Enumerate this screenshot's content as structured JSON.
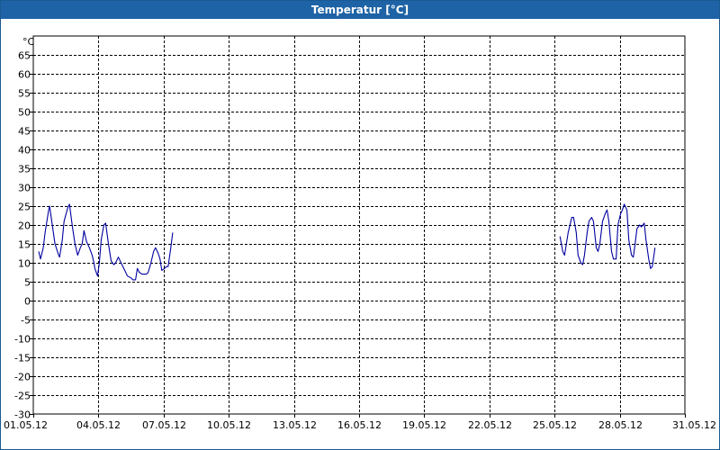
{
  "window": {
    "title": "Temperatur [°C]"
  },
  "chart_data": {
    "type": "line",
    "title": "Temperatur [°C]",
    "ylabel": "°C",
    "ylim": [
      -30,
      70
    ],
    "yticks": [
      -30,
      -25,
      -20,
      -15,
      -10,
      -5,
      0,
      5,
      10,
      15,
      20,
      25,
      30,
      35,
      40,
      45,
      50,
      55,
      60,
      65
    ],
    "xlim": [
      "01.05.12",
      "31.05.12"
    ],
    "xticks": [
      "01.05.12",
      "04.05.12",
      "07.05.12",
      "10.05.12",
      "13.05.12",
      "16.05.12",
      "19.05.12",
      "22.05.12",
      "25.05.12",
      "28.05.12",
      "31.05.12"
    ],
    "grid": true,
    "line_color": "#0000a0",
    "series": [
      {
        "segments": [
          [
            [
              "01.05.12 06:00",
              13
            ],
            [
              "01.05.12 08:00",
              11
            ],
            [
              "01.05.12 11:00",
              14
            ],
            [
              "01.05.12 13:00",
              18
            ],
            [
              "01.05.12 17:00",
              24
            ],
            [
              "01.05.12 18:00",
              25
            ],
            [
              "01.05.12 21:00",
              20
            ],
            [
              "02.05.12 00:00",
              15
            ],
            [
              "02.05.12 04:00",
              12
            ],
            [
              "02.05.12 05:00",
              11.5
            ],
            [
              "02.05.12 08:00",
              16
            ],
            [
              "02.05.12 10:00",
              21
            ],
            [
              "02.05.12 14:00",
              24.5
            ],
            [
              "02.05.12 16:00",
              25.5
            ],
            [
              "02.05.12 19:00",
              20
            ],
            [
              "02.05.12 22:00",
              15
            ],
            [
              "03.05.12 01:00",
              12
            ],
            [
              "03.05.12 04:00",
              14
            ],
            [
              "03.05.12 06:00",
              15
            ],
            [
              "03.05.12 08:00",
              18.5
            ],
            [
              "03.05.12 11:00",
              15.5
            ],
            [
              "03.05.12 14:00",
              14
            ],
            [
              "03.05.12 17:00",
              12
            ],
            [
              "03.05.12 19:00",
              10
            ],
            [
              "03.05.12 20:00",
              8.5
            ],
            [
              "03.05.12 23:00",
              6.5
            ],
            [
              "04.05.12 01:00",
              10
            ],
            [
              "04.05.12 03:00",
              16
            ],
            [
              "04.05.12 06:00",
              20
            ],
            [
              "04.05.12 08:00",
              20.5
            ],
            [
              "04.05.12 11:00",
              15
            ],
            [
              "04.05.12 14:00",
              10.5
            ],
            [
              "04.05.12 17:00",
              9.5
            ],
            [
              "04.05.12 19:00",
              10
            ],
            [
              "04.05.12 22:00",
              11.5
            ],
            [
              "05.05.12 01:00",
              10
            ],
            [
              "05.05.12 05:00",
              8
            ],
            [
              "05.05.12 08:00",
              6.5
            ],
            [
              "05.05.12 12:00",
              6
            ],
            [
              "05.05.12 14:00",
              5.5
            ],
            [
              "05.05.12 17:00",
              5.5
            ],
            [
              "05.05.12 19:00",
              8.5
            ],
            [
              "05.05.12 21:00",
              7.5
            ],
            [
              "06.05.12 00:00",
              7
            ],
            [
              "06.05.12 05:00",
              7
            ],
            [
              "06.05.12 07:00",
              7.5
            ],
            [
              "06.05.12 10:00",
              10
            ],
            [
              "06.05.12 13:00",
              13
            ],
            [
              "06.05.12 15:00",
              14
            ],
            [
              "06.05.12 18:00",
              12.5
            ],
            [
              "06.05.12 20:00",
              11
            ],
            [
              "06.05.12 22:00",
              8
            ],
            [
              "07.05.12 01:00",
              8.5
            ],
            [
              "07.05.12 03:00",
              9
            ],
            [
              "07.05.12 05:00",
              9
            ],
            [
              "07.05.12 08:00",
              14
            ],
            [
              "07.05.12 10:00",
              18
            ]
          ],
          [
            [
              "25.05.12 06:00",
              17
            ],
            [
              "25.05.12 09:00",
              13
            ],
            [
              "25.05.12 11:00",
              12
            ],
            [
              "25.05.12 13:00",
              15
            ],
            [
              "25.05.12 15:00",
              18
            ],
            [
              "25.05.12 19:00",
              22
            ],
            [
              "25.05.12 21:00",
              22
            ],
            [
              "26.05.12 00:00",
              18
            ],
            [
              "26.05.12 02:00",
              12
            ],
            [
              "26.05.12 05:00",
              10
            ],
            [
              "26.05.12 07:00",
              9.5
            ],
            [
              "26.05.12 09:00",
              12
            ],
            [
              "26.05.12 12:00",
              18
            ],
            [
              "26.05.12 14:00",
              21
            ],
            [
              "26.05.12 17:00",
              22
            ],
            [
              "26.05.12 19:00",
              21
            ],
            [
              "26.05.12 22:00",
              14
            ],
            [
              "27.05.12 00:00",
              13
            ],
            [
              "27.05.12 02:00",
              15
            ],
            [
              "27.05.12 05:00",
              21
            ],
            [
              "27.05.12 08:00",
              23
            ],
            [
              "27.05.12 10:00",
              24
            ],
            [
              "27.05.12 12:00",
              21
            ],
            [
              "27.05.12 15:00",
              13
            ],
            [
              "27.05.12 17:00",
              11
            ],
            [
              "27.05.12 20:00",
              11
            ],
            [
              "27.05.12 22:00",
              20
            ],
            [
              "28.05.12 01:00",
              23
            ],
            [
              "28.05.12 03:00",
              24
            ],
            [
              "28.05.12 05:00",
              25.5
            ],
            [
              "28.05.12 08:00",
              24
            ],
            [
              "28.05.12 10:00",
              16
            ],
            [
              "28.05.12 13:00",
              12
            ],
            [
              "28.05.12 15:00",
              11.5
            ],
            [
              "28.05.12 17:00",
              15
            ],
            [
              "28.05.12 19:00",
              19
            ],
            [
              "28.05.12 22:00",
              20
            ],
            [
              "29.05.12 00:00",
              19.5
            ],
            [
              "29.05.12 03:00",
              20.5
            ],
            [
              "29.05.12 05:00",
              16
            ],
            [
              "29.05.12 08:00",
              11
            ],
            [
              "29.05.12 10:00",
              8.5
            ],
            [
              "29.05.12 12:00",
              9
            ],
            [
              "29.05.12 15:00",
              14
            ]
          ]
        ]
      }
    ]
  }
}
